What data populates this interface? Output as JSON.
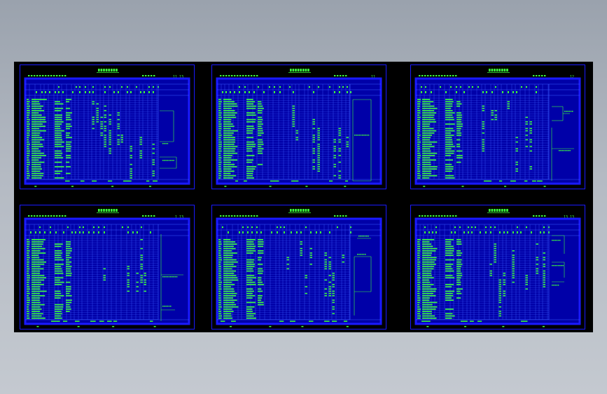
{
  "viewer": {
    "background": "#a4abb5",
    "canvas_color": "#000000"
  },
  "colors": {
    "frame": "#1a1aff",
    "table_fill": "#0000a8",
    "grid": "#3b5cff",
    "text": "#3cff3c",
    "title": "#3cff3c"
  },
  "sheets": [
    {
      "id": "sheet-1",
      "title_icon": "title-text-glyphs",
      "page_tag": "11 13",
      "diagram": "left-block"
    },
    {
      "id": "sheet-2",
      "title_icon": "title-text-glyphs",
      "page_tag": "11",
      "diagram": "tall-box"
    },
    {
      "id": "sheet-3",
      "title_icon": "title-text-glyphs",
      "page_tag": "12",
      "diagram": "brackets"
    },
    {
      "id": "sheet-4",
      "title_icon": "title-text-glyphs",
      "page_tag": "1 13",
      "diagram": "tall-box-low"
    },
    {
      "id": "sheet-5",
      "title_icon": "title-text-glyphs",
      "page_tag": "",
      "diagram": "mid-box"
    },
    {
      "id": "sheet-6",
      "title_icon": "title-text-glyphs",
      "page_tag": "13 13",
      "diagram": "small-brackets"
    }
  ]
}
